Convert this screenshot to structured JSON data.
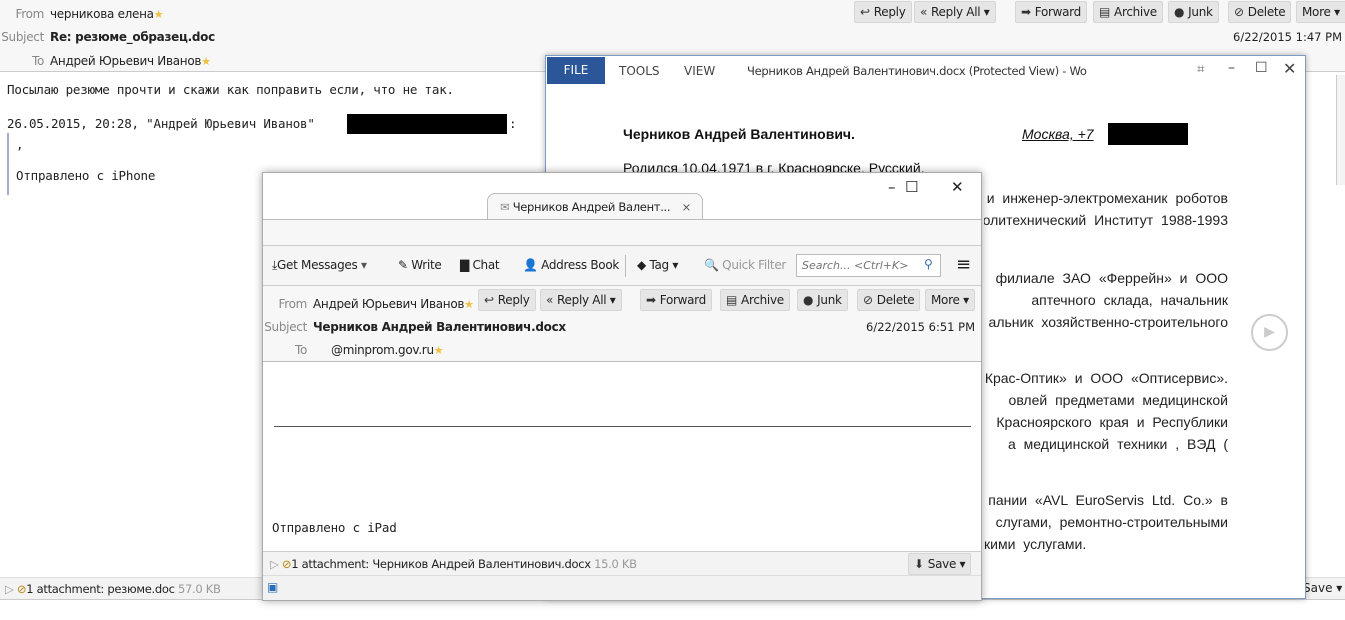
{
  "bg_mail": {
    "from_label": "From",
    "from": "черникова елена",
    "subject_label": "Subject",
    "subject": "Re: резюме_образец.doc",
    "to_label": "To",
    "to": "Андрей Юрьевич Иванов",
    "date": "6/22/2015 1:47 PM",
    "buttons": [
      "Reply",
      "Reply All",
      "Forward",
      "Archive",
      "Junk",
      "Delete",
      "More"
    ],
    "body": [
      "Посылаю резюме прочти и скажи как поправить если, что не так.",
      "26.05.2015, 20:28, \"Андрей Юрьевич Иванов\"",
      ":",
      ",",
      "Отправлено с iPhone"
    ],
    "attachment": "1 attachment: резюме.doc",
    "attachment_size": "57.0 KB",
    "save": "Save"
  },
  "word": {
    "tabs": [
      "FILE",
      "TOOLS",
      "VIEW"
    ],
    "title": "Черников Андрей Валентинович.docx (Protected View) - Word",
    "name": "Черников Андрей Валентинович.",
    "city": "Москва,   +7",
    "born": "Родился 10.04.1971 в г. Красноярске. Русский.",
    "lines": [
      "и инженер-электромеханик роботов",
      "олитехнический Институт 1988-1993",
      "",
      "филиале ЗАО «Феррейн» и ООО",
      "аптечного склада, начальник",
      "альник хозяйственно-строительного",
      "",
      "«Крас-Оптик» и ООО «Оптисервис».",
      "овлей предметами медицинской",
      "Красноярского края и Республики",
      "а медицинской  техники , ВЭД (",
      "",
      "пании «AVL EuroServis Ltd. Co.» в",
      "слугами,  ремонтно-строительными",
      "кими услугами."
    ]
  },
  "tb": {
    "tab_title": "Черников Андрей Валент...",
    "toolbar": {
      "get_messages": "Get Messages",
      "write": "Write",
      "chat": "Chat",
      "address_book": "Address Book",
      "tag": "Tag",
      "quick_filter": "Quick Filter",
      "search_placeholder": "Search... <Ctrl+K>"
    },
    "from_label": "From",
    "from": "Андрей Юрьевич Иванов",
    "subject_label": "Subject",
    "subject": "Черников Андрей Валентинович.docx",
    "to_label": "To",
    "to": "@minprom.gov.ru",
    "date": "6/22/2015 6:51 PM",
    "buttons": [
      "Reply",
      "Reply All",
      "Forward",
      "Archive",
      "Junk",
      "Delete",
      "More"
    ],
    "body": "Отправлено с iPad",
    "attachment": "1 attachment: Черников Андрей Валентинович.docx",
    "attachment_size": "15.0 KB",
    "save": "Save"
  }
}
